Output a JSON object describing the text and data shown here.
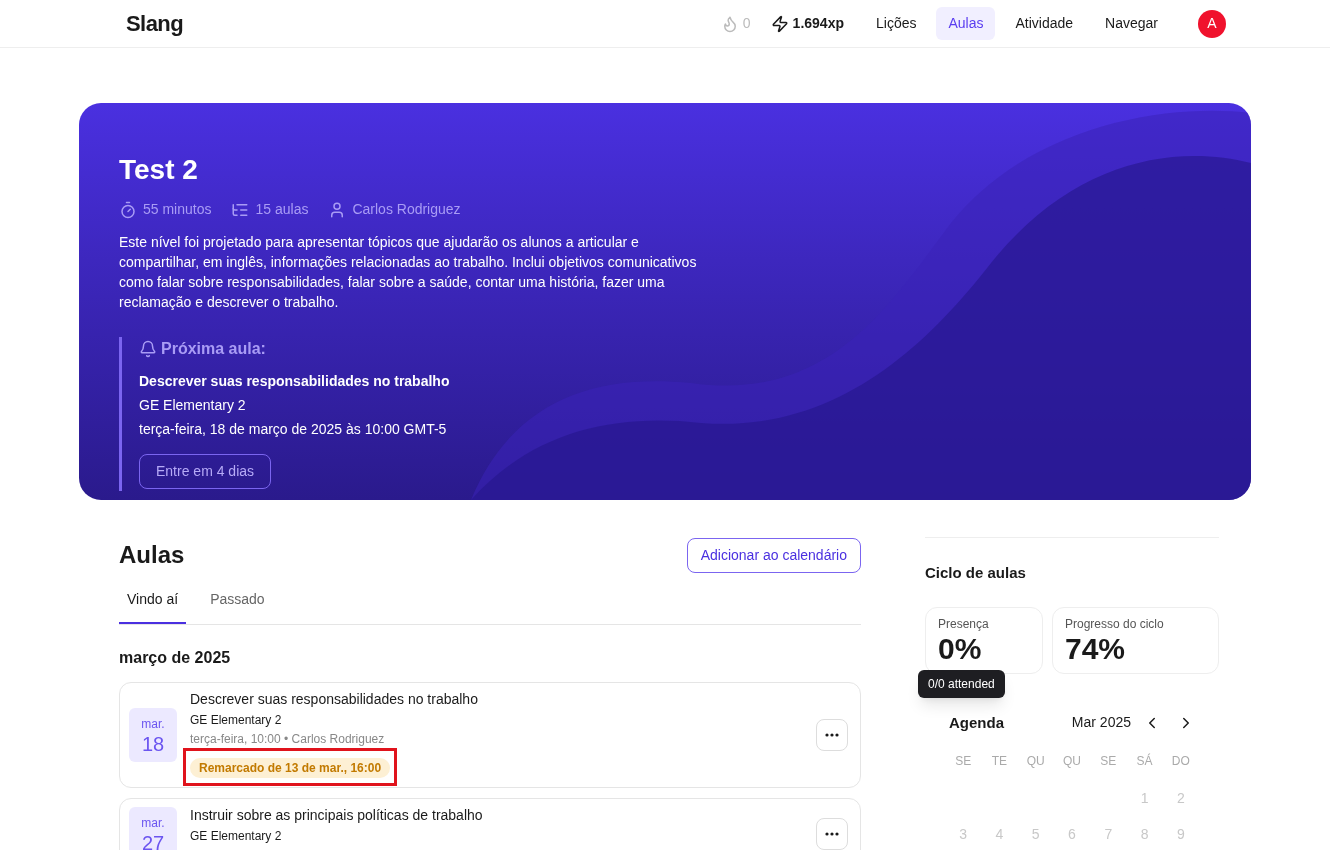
{
  "header": {
    "logo": "Slang",
    "streak": "0",
    "xp": "1.694xp",
    "nav": [
      {
        "label": "Lições",
        "selected": false
      },
      {
        "label": "Aulas",
        "selected": true
      },
      {
        "label": "Atividade",
        "selected": false
      },
      {
        "label": "Navegar",
        "selected": false
      }
    ],
    "avatar": "A"
  },
  "hero": {
    "title": "Test 2",
    "meta": [
      {
        "kind": "duration",
        "text": "55 minutos"
      },
      {
        "kind": "lessons",
        "text": "15 aulas"
      },
      {
        "kind": "teacher",
        "text": "Carlos Rodriguez"
      }
    ],
    "description": "Este nível foi projetado para apresentar tópicos que ajudarão os alunos a articular e compartilhar, em inglês, informações relacionadas ao trabalho. Inclui objetivos comunicativos como falar sobre responsabilidades, falar sobre a saúde, contar uma história, fazer uma reclamação e descrever o trabalho.",
    "next": {
      "heading": "Próxima aula:",
      "title": "Descrever suas responsabilidades no trabalho",
      "group": "GE Elementary 2",
      "when": "terça-feira, 18 de março de 2025 às 10:00 GMT-5",
      "button": "Entre em 4 dias"
    }
  },
  "lessons": {
    "title": "Aulas",
    "calendar_button": "Adicionar ao calendário",
    "tabs": [
      {
        "label": "Vindo aí",
        "selected": true
      },
      {
        "label": "Passado",
        "selected": false
      }
    ],
    "month": "março de 2025",
    "items": [
      {
        "month": "mar.",
        "day": "18",
        "title": "Descrever suas responsabilidades no trabalho",
        "group": "GE Elementary 2",
        "when": "terça-feira, 10:00 • Carlos Rodriguez",
        "badge": "Remarcado de 13 de mar., 16:00",
        "highlighted": true
      },
      {
        "month": "mar.",
        "day": "27",
        "title": "Instruir sobre as principais políticas de trabalho",
        "group": "GE Elementary 2"
      }
    ]
  },
  "cycle": {
    "title": "Ciclo de aulas",
    "stats": [
      {
        "label": "Presença",
        "value": "0%",
        "tooltip": "0/0 attended"
      },
      {
        "label": "Progresso do ciclo",
        "value": "74%"
      }
    ],
    "agenda": {
      "title": "Agenda",
      "month": "Mar 2025",
      "weekdays": [
        "SE",
        "TE",
        "QU",
        "QU",
        "SE",
        "SÁ",
        "DO"
      ],
      "weeks": [
        [
          "1",
          "2"
        ],
        [
          "3",
          "4",
          "5",
          "6",
          "7",
          "8",
          "9"
        ]
      ]
    }
  }
}
